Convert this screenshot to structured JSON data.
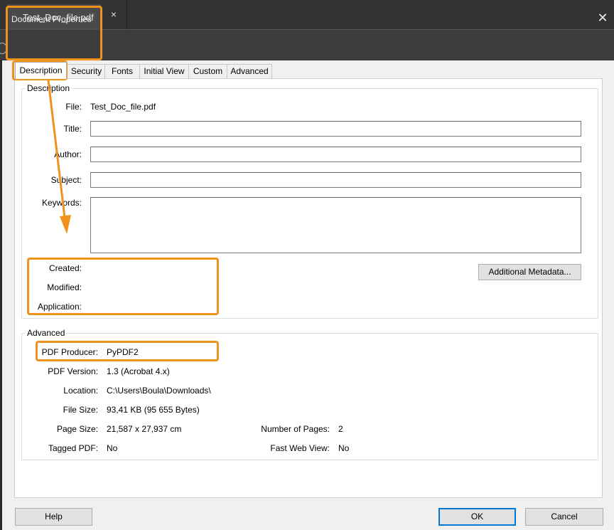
{
  "app": {
    "tab_label": "Test_Doc_file.pdf",
    "tab_close_glyph": "×"
  },
  "dialog": {
    "title": "Document Properties",
    "close_glyph": "✕"
  },
  "tabs": [
    {
      "label": "Description"
    },
    {
      "label": "Security"
    },
    {
      "label": "Fonts"
    },
    {
      "label": "Initial View"
    },
    {
      "label": "Custom"
    },
    {
      "label": "Advanced"
    }
  ],
  "description": {
    "legend": "Description",
    "file_label": "File:",
    "file_value": "Test_Doc_file.pdf",
    "title_label": "Title:",
    "title_value": "",
    "author_label": "Author:",
    "author_value": "",
    "subject_label": "Subject:",
    "subject_value": "",
    "keywords_label": "Keywords:",
    "keywords_value": "",
    "created_label": "Created:",
    "modified_label": "Modified:",
    "application_label": "Application:",
    "additional_metadata_button": "Additional Metadata..."
  },
  "advanced": {
    "legend": "Advanced",
    "pdf_producer_label": "PDF Producer:",
    "pdf_producer_value": "PyPDF2",
    "pdf_version_label": "PDF Version:",
    "pdf_version_value": "1.3 (Acrobat 4.x)",
    "location_label": "Location:",
    "location_value": "C:\\Users\\Boula\\Downloads\\",
    "file_size_label": "File Size:",
    "file_size_value": "93,41 KB (95 655 Bytes)",
    "page_size_label": "Page Size:",
    "page_size_value": "21,587 x 27,937 cm",
    "num_pages_label": "Number of Pages:",
    "num_pages_value": "2",
    "tagged_pdf_label": "Tagged PDF:",
    "tagged_pdf_value": "No",
    "fast_web_view_label": "Fast Web View:",
    "fast_web_view_value": "No"
  },
  "footer": {
    "help_button": "Help",
    "ok_button": "OK",
    "cancel_button": "Cancel"
  },
  "colors": {
    "highlight": "#f0921b",
    "dark_chrome": "#323232",
    "focus_border": "#0078d7"
  }
}
